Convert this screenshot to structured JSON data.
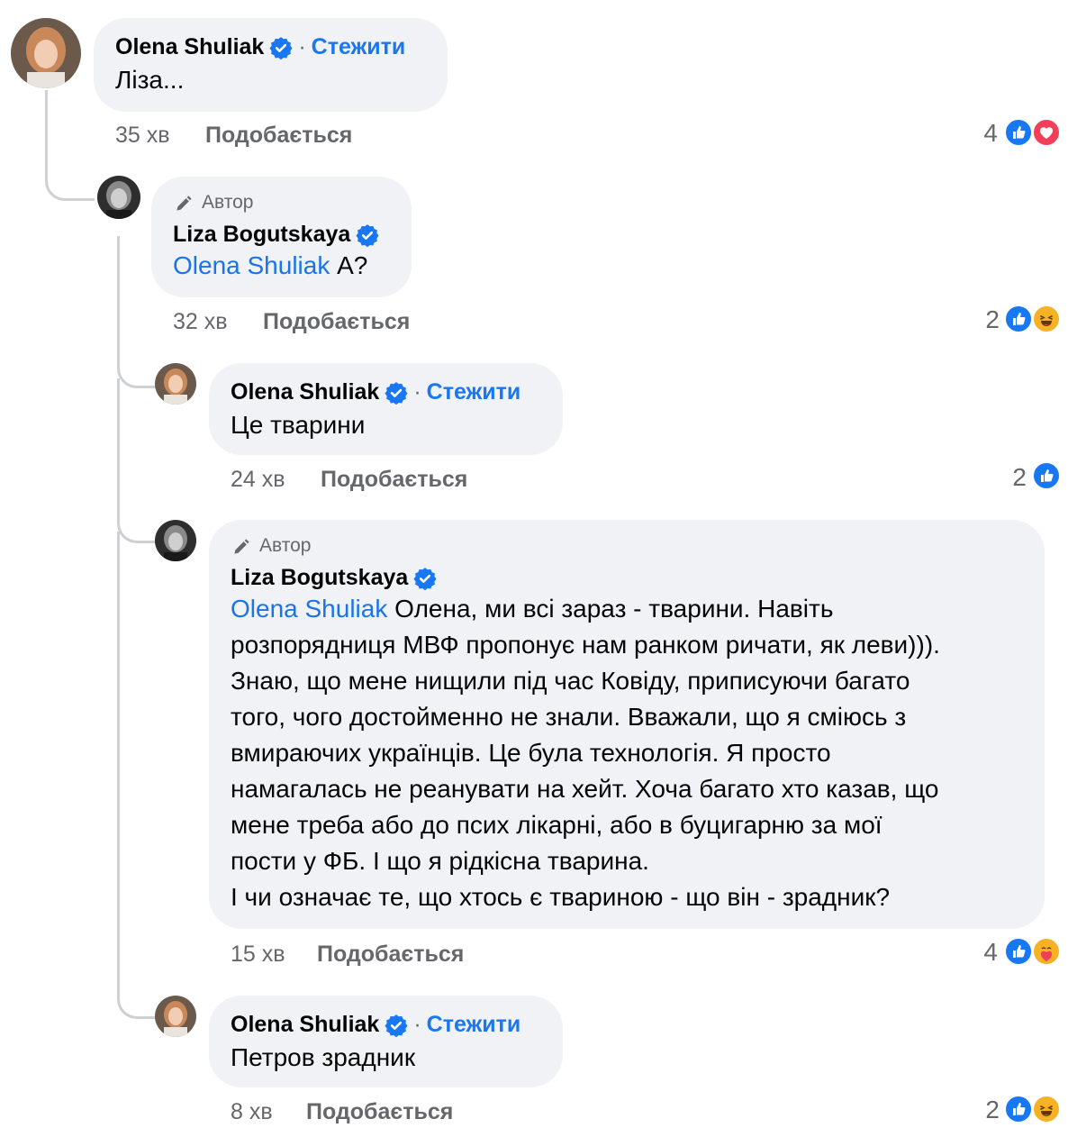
{
  "comments": [
    {
      "author": "Olena Shuliak",
      "follow": "Стежити",
      "text": "Ліза...",
      "time": "35 хв",
      "like": "Подобається",
      "count": "4",
      "reactions": [
        "like",
        "love"
      ]
    },
    {
      "author_tag": "Автор",
      "author": "Liza Bogutskaya",
      "mention": "Olena Shuliak",
      "text": " А?",
      "time": "32 хв",
      "like": "Подобається",
      "count": "2",
      "reactions": [
        "like",
        "haha"
      ]
    },
    {
      "author": "Olena Shuliak",
      "follow": "Стежити",
      "text": "Це тварини",
      "time": "24 хв",
      "like": "Подобається",
      "count": "2",
      "reactions": [
        "like"
      ]
    },
    {
      "author_tag": "Автор",
      "author": "Liza Bogutskaya",
      "mention": "Olena Shuliak",
      "lines": [
        " Олена, ми всі зараз - тварини. Навіть",
        "розпорядниця МВФ пропонує нам ранком ричати, як леви))).",
        "Знаю, що мене нищили під час Ковіду, приписуючи багато",
        "того, чого достойменно не знали. Вважали, що я сміюсь з",
        "вмираючих українців. Це була технологія. Я просто",
        "намагалась не реанувати на хейт. Хоча багато хто казав, що",
        "мене треба або до псих лікарні, або в буцигарню за мої",
        "пости у ФБ. І що я рідкісна тварина.",
        "І чи означає те, що хтось є твариною - що він - зрадник?"
      ],
      "time": "15 хв",
      "like": "Подобається",
      "count": "4",
      "reactions": [
        "like",
        "care"
      ]
    },
    {
      "author": "Olena Shuliak",
      "follow": "Стежити",
      "text": "Петров зрадник",
      "time": "8 хв",
      "like": "Подобається",
      "count": "2",
      "reactions": [
        "like",
        "haha"
      ]
    }
  ],
  "separator": "·",
  "colors": {
    "bubble": "#f0f2f5",
    "link": "#1877f2",
    "meta": "#65676b",
    "like": "#1877f2",
    "love": "#f33e58",
    "haha": "#f7b125"
  }
}
